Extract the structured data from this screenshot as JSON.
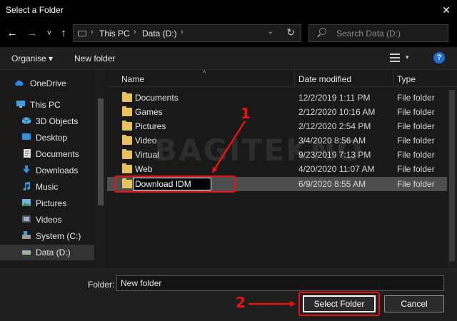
{
  "window": {
    "title": "Select a Folder"
  },
  "nav": {
    "back": "←",
    "forward": "→",
    "recent": "˅",
    "up": "↑"
  },
  "address": {
    "crumbs": [
      "This PC",
      "Data (D:)"
    ],
    "separator": "›",
    "dropdown": "⌵",
    "refresh": "↻"
  },
  "search": {
    "placeholder": "Search Data (D:)"
  },
  "toolbar": {
    "organise": "Organise ▾",
    "new_folder": "New folder",
    "view_dropdown": "▾",
    "help": "?"
  },
  "sidebar": {
    "items": [
      {
        "label": "OneDrive",
        "icon": "cloud-icon"
      },
      {
        "label": "This PC",
        "icon": "computer-icon"
      },
      {
        "label": "3D Objects",
        "icon": "cube-icon"
      },
      {
        "label": "Desktop",
        "icon": "desktop-icon"
      },
      {
        "label": "Documents",
        "icon": "document-icon"
      },
      {
        "label": "Downloads",
        "icon": "download-arrow-icon"
      },
      {
        "label": "Music",
        "icon": "music-note-icon"
      },
      {
        "label": "Pictures",
        "icon": "picture-icon"
      },
      {
        "label": "Videos",
        "icon": "video-icon"
      },
      {
        "label": "System (C:)",
        "icon": "system-drive-icon"
      },
      {
        "label": "Data (D:)",
        "icon": "drive-icon",
        "selected": true
      }
    ]
  },
  "columns": {
    "name": "Name",
    "date": "Date modified",
    "type": "Type"
  },
  "files": [
    {
      "name": "Documents",
      "date": "12/2/2019 1:11 PM",
      "type": "File folder"
    },
    {
      "name": "Games",
      "date": "2/12/2020 10:16 AM",
      "type": "File folder"
    },
    {
      "name": "Pictures",
      "date": "2/12/2020 2:54 PM",
      "type": "File folder"
    },
    {
      "name": "Video",
      "date": "3/4/2020 8:56 AM",
      "type": "File folder"
    },
    {
      "name": "Virtual",
      "date": "9/23/2019 7:13 PM",
      "type": "File folder"
    },
    {
      "name": "Web",
      "date": "4/20/2020 11:07 AM",
      "type": "File folder"
    },
    {
      "name": "Download IDM",
      "date": "6/9/2020 8:55 AM",
      "type": "File folder",
      "editing": true
    }
  ],
  "watermark": "BAGITEKNO",
  "footer": {
    "folder_label": "Folder:",
    "folder_value": "New folder",
    "select_button": "Select Folder",
    "cancel_button": "Cancel"
  },
  "annotations": {
    "step1": "1",
    "step2": "2",
    "color": "#ee1111"
  }
}
